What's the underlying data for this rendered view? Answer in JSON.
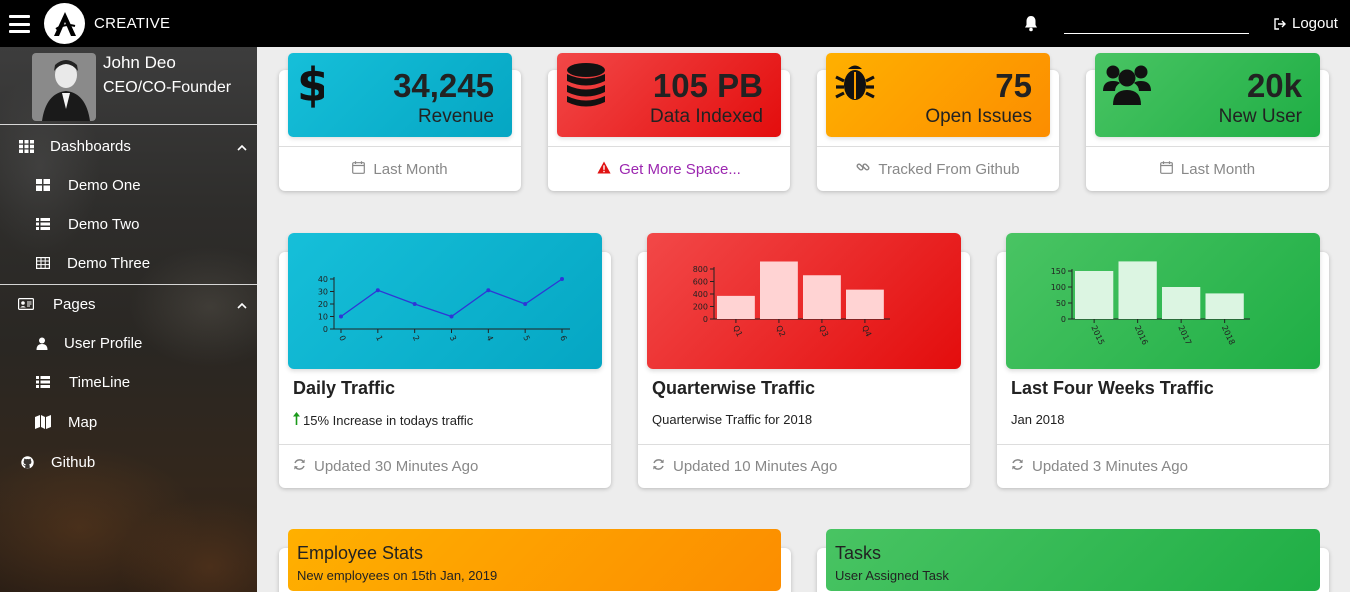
{
  "navbar": {
    "brand": "CREATIVE",
    "search": {
      "value": "",
      "placeholder": ""
    },
    "logout_label": "Logout"
  },
  "sidebar": {
    "user": {
      "name": "John Deo",
      "role": "CEO/CO-Founder"
    },
    "sections": [
      {
        "label": "Dashboards",
        "items": [
          {
            "label": "Demo One"
          },
          {
            "label": "Demo Two"
          },
          {
            "label": "Demo Three"
          }
        ]
      },
      {
        "label": "Pages",
        "items": [
          {
            "label": "User Profile"
          },
          {
            "label": "TimeLine"
          },
          {
            "label": "Map"
          }
        ]
      }
    ],
    "github_label": "Github"
  },
  "stats": [
    {
      "value": "34,245",
      "label": "Revenue",
      "footer": "Last Month",
      "color": "#0fb5d0",
      "icon": "dollar-icon"
    },
    {
      "value": "105 PB",
      "label": "Data Indexed",
      "footer": "Get More Space...",
      "color": "#ec2222",
      "icon": "database-icon",
      "footer_color": "#9c27b0",
      "footer_icon_color": "#e01212"
    },
    {
      "value": "75",
      "label": "Open Issues",
      "footer": "Tracked From Github",
      "color": "#fd9f00",
      "icon": "bug-icon"
    },
    {
      "value": "20k",
      "label": "New User",
      "footer": "Last Month",
      "color": "#35b954",
      "icon": "users-icon"
    }
  ],
  "charts": [
    {
      "title": "Daily Traffic",
      "subtitle": "15% Increase in todays traffic",
      "footer": "Updated 30 Minutes Ago"
    },
    {
      "title": "Quarterwise Traffic",
      "subtitle": "Quarterwise Traffic for 2018",
      "footer": "Updated 10 Minutes Ago"
    },
    {
      "title": "Last Four Weeks Traffic",
      "subtitle": "Jan 2018",
      "footer": "Updated 3 Minutes Ago"
    }
  ],
  "chart_data": [
    {
      "type": "line",
      "x": [
        0,
        1,
        2,
        3,
        4,
        5,
        6
      ],
      "values": [
        10,
        31,
        20,
        10,
        31,
        20,
        40
      ],
      "ylim": [
        0,
        40
      ],
      "yticks": [
        0,
        10,
        20,
        30,
        40
      ],
      "color": "#2f36d6"
    },
    {
      "type": "bar",
      "categories": [
        "Q1",
        "Q2",
        "Q3",
        "Q4"
      ],
      "values": [
        370,
        920,
        700,
        470
      ],
      "ylim": [
        0,
        800
      ],
      "yticks": [
        0,
        200,
        400,
        600,
        800
      ],
      "color": "#ffd3d3"
    },
    {
      "type": "bar",
      "categories": [
        "2015",
        "2016",
        "2017",
        "2018"
      ],
      "values": [
        150,
        180,
        100,
        80
      ],
      "ylim": [
        0,
        150
      ],
      "yticks": [
        0,
        50,
        100,
        150
      ],
      "color": "#dcf5e2"
    }
  ],
  "bottom_cards": [
    {
      "title": "Employee Stats",
      "subtitle": "New employees on 15th Jan, 2019",
      "color": "#fd9f00"
    },
    {
      "title": "Tasks",
      "subtitle": "User Assigned Task",
      "color": "#35b954"
    }
  ]
}
